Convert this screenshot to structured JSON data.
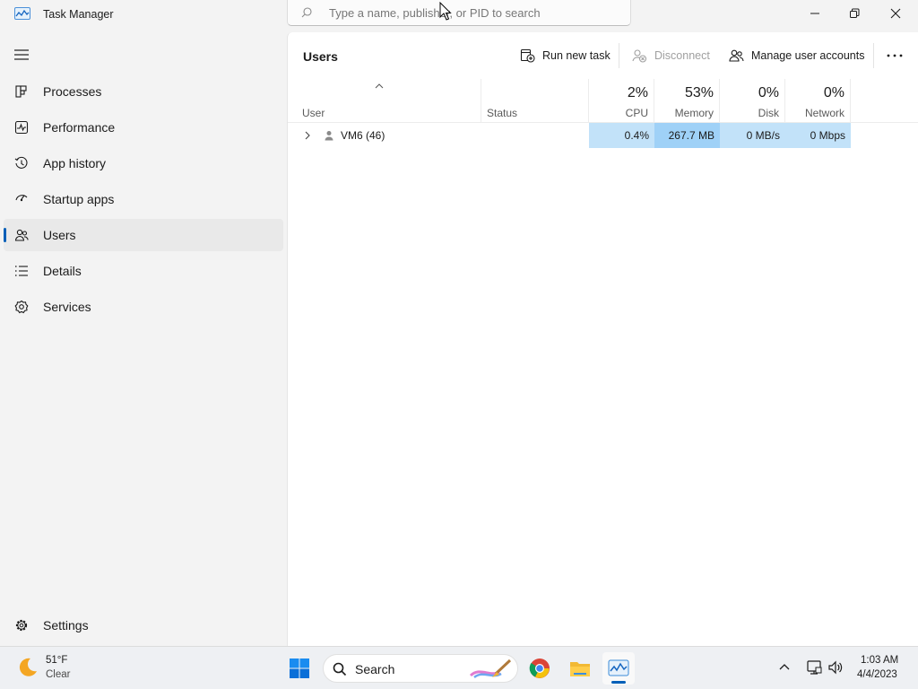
{
  "window": {
    "title": "Task Manager",
    "search_placeholder": "Type a name, publisher, or PID to search"
  },
  "sidebar": {
    "items": [
      {
        "label": "Processes",
        "icon": "processes-icon",
        "active": false
      },
      {
        "label": "Performance",
        "icon": "performance-icon",
        "active": false
      },
      {
        "label": "App history",
        "icon": "app-history-icon",
        "active": false
      },
      {
        "label": "Startup apps",
        "icon": "startup-apps-icon",
        "active": false
      },
      {
        "label": "Users",
        "icon": "users-icon",
        "active": true
      },
      {
        "label": "Details",
        "icon": "details-icon",
        "active": false
      },
      {
        "label": "Services",
        "icon": "services-icon",
        "active": false
      }
    ],
    "settings_label": "Settings"
  },
  "main": {
    "title": "Users",
    "toolbar": {
      "run_new_task": "Run new task",
      "disconnect": "Disconnect",
      "manage_user_accounts": "Manage user accounts"
    },
    "columns": {
      "user": "User",
      "status": "Status",
      "cpu": {
        "pct": "2%",
        "label": "CPU"
      },
      "memory": {
        "pct": "53%",
        "label": "Memory"
      },
      "disk": {
        "pct": "0%",
        "label": "Disk"
      },
      "network": {
        "pct": "0%",
        "label": "Network"
      }
    },
    "rows": [
      {
        "user": "VM6 (46)",
        "status": "",
        "cpu": "0.4%",
        "memory": "267.7 MB",
        "disk": "0 MB/s",
        "network": "0 Mbps"
      }
    ]
  },
  "taskbar": {
    "weather": {
      "temp": "51°F",
      "condition": "Clear"
    },
    "search_label": "Search",
    "clock": {
      "time": "1:03 AM",
      "date": "4/4/2023"
    }
  },
  "colors": {
    "accent": "#005fb8",
    "cpu_cell": "#c2e2f9",
    "memory_cell": "#9fd1f7",
    "disk_network_cell": "#c2e2f9"
  }
}
